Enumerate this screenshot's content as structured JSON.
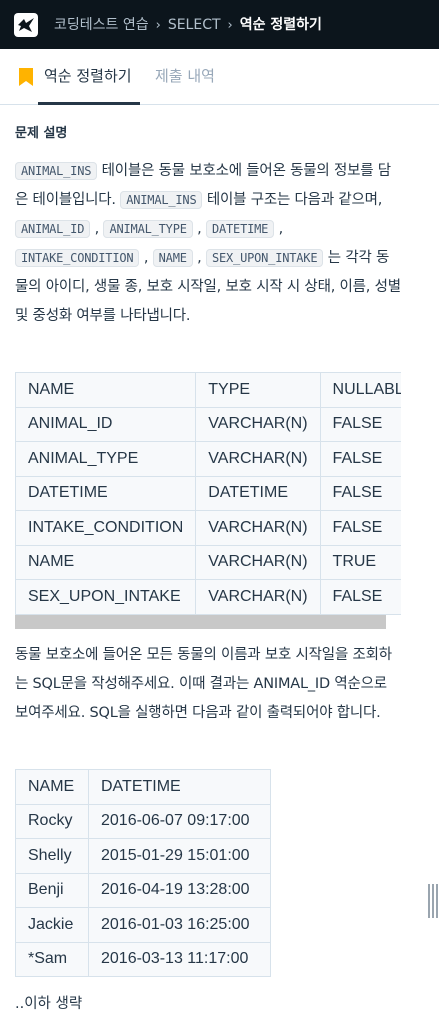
{
  "header": {
    "logo_icon": "programmers-bird-logo-icon",
    "breadcrumbs": [
      "코딩테스트 연습",
      "SELECT",
      "역순 정렬하기"
    ],
    "separator": "›"
  },
  "tabs": {
    "active": "역순 정렬하기",
    "other": "제출 내역",
    "bookmark_icon": "bookmark-icon",
    "bookmark_color": "#ffb300"
  },
  "problem": {
    "section_title": "문제 설명",
    "intro": {
      "code_table": "ANIMAL_INS",
      "text1": " 테이블은 동물 보호소에 들어온 동물의 정보를 담은 테이블입니다. ",
      "code_table2": "ANIMAL_INS",
      "text2": " 테이블 구조는 다음과 같으며, ",
      "cols": [
        "ANIMAL_ID",
        "ANIMAL_TYPE",
        "DATETIME",
        "INTAKE_CONDITION",
        "NAME",
        "SEX_UPON_INTAKE"
      ],
      "comma": " , ",
      "text3": " 는 각각 동물의 아이디, 생물 종, 보호 시작일, 보호 시작 시 상태, 이름, 성별 및 중성화 여부를 나타냅니다."
    },
    "schema_table": {
      "headers": [
        "NAME",
        "TYPE",
        "NULLABLE"
      ],
      "rows": [
        [
          "ANIMAL_ID",
          "VARCHAR(N)",
          "FALSE"
        ],
        [
          "ANIMAL_TYPE",
          "VARCHAR(N)",
          "FALSE"
        ],
        [
          "DATETIME",
          "DATETIME",
          "FALSE"
        ],
        [
          "INTAKE_CONDITION",
          "VARCHAR(N)",
          "FALSE"
        ],
        [
          "NAME",
          "VARCHAR(N)",
          "TRUE"
        ],
        [
          "SEX_UPON_INTAKE",
          "VARCHAR(N)",
          "FALSE"
        ]
      ]
    },
    "task": "동물 보호소에 들어온 모든 동물의 이름과 보호 시작일을 조회하는 SQL문을 작성해주세요. 이때 결과는 ANIMAL_ID 역순으로 보여주세요. SQL을 실행하면 다음과 같이 출력되어야 합니다.",
    "result_table": {
      "headers": [
        "NAME",
        "DATETIME"
      ],
      "rows": [
        [
          "Rocky",
          "2016-06-07 09:17:00"
        ],
        [
          "Shelly",
          "2015-01-29 15:01:00"
        ],
        [
          "Benji",
          "2016-04-19 13:28:00"
        ],
        [
          "Jackie",
          "2016-01-03 16:25:00"
        ],
        [
          "*Sam",
          "2016-03-13 11:17:00"
        ]
      ]
    },
    "footer": "..이하 생략"
  }
}
